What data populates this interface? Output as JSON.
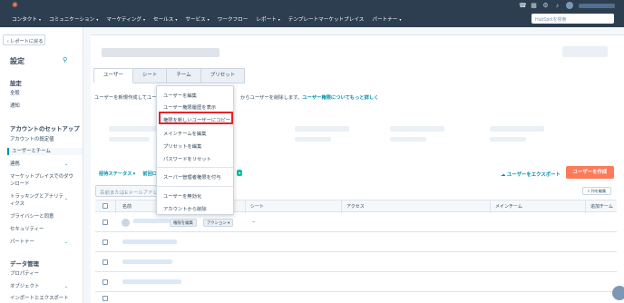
{
  "colors": {
    "nav_bg": "#2d3e50",
    "accent": "#ff7a59",
    "link": "#0091ae",
    "highlight": "#e5242a"
  },
  "topnav": {
    "menu": [
      "コンタクト",
      "コミュニケーション",
      "マーケティング",
      "セールス",
      "サービス",
      "ワークフロー",
      "レポート",
      "テンプレートマーケットプレイス",
      "パートナー"
    ],
    "search_placeholder": "HubSpotを検索"
  },
  "sidebar": {
    "back_label": "‹ レポートに戻る",
    "title": "設定",
    "section1": "設定",
    "items1": [
      "全般",
      "通知"
    ],
    "section2": "アカウントのセットアップ",
    "items2": [
      "アカウントの既定値",
      "ユーザーとチーム",
      "連携",
      "マーケットプレイスでのダウンロード",
      "トラッキングとアナリティクス",
      "プライバシーと同意",
      "セキュリティー",
      "パートナー"
    ],
    "section3": "データ管理",
    "items3": [
      "プロパティー",
      "オブジェクト",
      "インポートとエクスポート"
    ]
  },
  "main": {
    "tabs": [
      "ユーザー",
      "シート",
      "チーム",
      "プリセット"
    ],
    "desc_left": "ユーザーを新規作成してユー",
    "desc_right": "からユーザーを削除します。",
    "desc_link": "ユーザー権限についてもっと詳しく",
    "filter_status": "招待ステータス",
    "filter_last": "前回ロ",
    "export_label": "ユーザーをエクスポート",
    "create_label": "ユーザーを作成",
    "search_placeholder": "名前またはEメールアドレ",
    "col_edit_label": "列を編集",
    "columns": [
      "名前",
      "シート",
      "アクセス",
      "メインチーム",
      "追加チーム"
    ],
    "row_edit_label": "権限を編集",
    "row_action_label": "アクション ▾",
    "dash": "--"
  },
  "dropdown": {
    "items": [
      "ユーザーを編集",
      "ユーザー権限履歴を表示",
      "権限を新しいユーザーにコピー",
      "メインチームを編集",
      "プリセットを編集",
      "パスワードをリセット",
      "スーパー管理者権限を付与",
      "ユーザーを無効化",
      "アカウントから削除"
    ],
    "highlighted": "権限を新しいユーザーにコピー"
  }
}
